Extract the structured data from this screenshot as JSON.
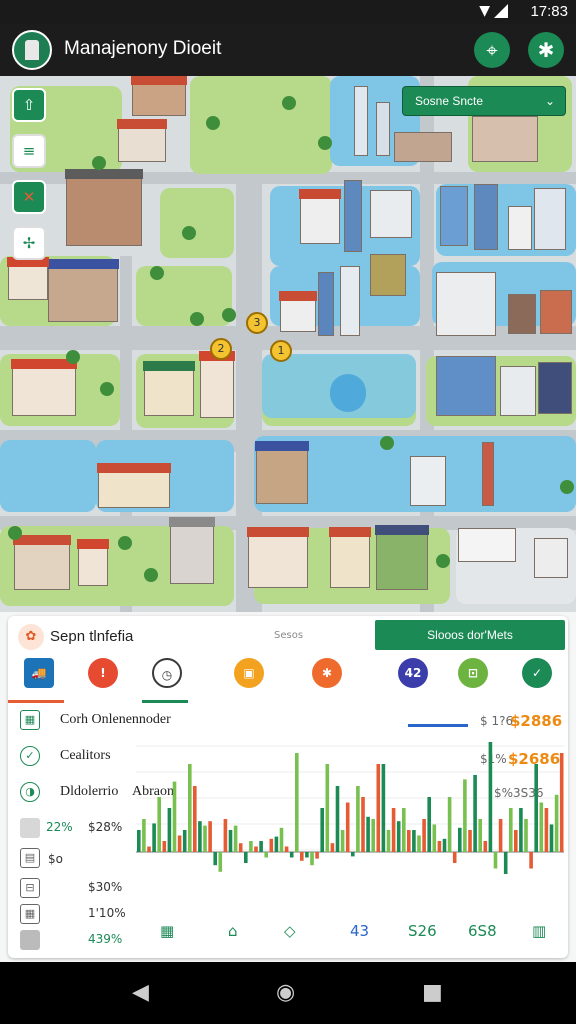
{
  "status": {
    "time": "17:83"
  },
  "app": {
    "title": "Manajenony Dioeit"
  },
  "map": {
    "dropdown_label": "Sosne Sncte",
    "side_buttons": [
      {
        "name": "compass-icon",
        "glyph": "⇧"
      },
      {
        "name": "layers-icon",
        "glyph": "≡"
      },
      {
        "name": "tools-icon",
        "glyph": "✕"
      },
      {
        "name": "fan-icon",
        "glyph": "✢"
      }
    ],
    "pins": [
      "3",
      "2",
      "1"
    ]
  },
  "panel": {
    "title": "Sepn tlnfefia",
    "subtitle": "Sesos",
    "cta_label": "Slooos dor'Mets",
    "categories": [
      {
        "name": "truck-icon",
        "glyph": "🚚",
        "color": "#1d73b8"
      },
      {
        "name": "alert-icon",
        "glyph": "!",
        "color": "#e64b32"
      },
      {
        "name": "clock-icon",
        "glyph": "◷",
        "color": "#3a3a3a"
      },
      {
        "name": "box-icon",
        "glyph": "▣",
        "color": "#f2a21e"
      },
      {
        "name": "gear-icon",
        "glyph": "✱",
        "color": "#ef6b2d"
      },
      {
        "name": "badge-icon",
        "glyph": "42",
        "color": "#3b3eaa"
      },
      {
        "name": "bag-icon",
        "glyph": "⊡",
        "color": "#6db33f"
      },
      {
        "name": "check-icon",
        "glyph": "✓",
        "color": "#1b8a55"
      }
    ],
    "rows": [
      {
        "label": "Corh Onlenennoder",
        "note": "$ 1?6",
        "amount": "$2886"
      },
      {
        "label": "Cealitors",
        "note": "$1%",
        "amount": "$2686"
      },
      {
        "label": "Dldolerrio",
        "sub": "Abraon",
        "note": "",
        "amount": "$%3S36"
      }
    ],
    "stats": [
      {
        "percent": "22%",
        "value": "$28%"
      },
      {
        "percent": "",
        "value": "$o"
      },
      {
        "percent": "",
        "value": "$30%"
      },
      {
        "percent": "",
        "value": "1'10%"
      },
      {
        "percent": "",
        "value": "439%"
      }
    ],
    "bottom_labels": [
      "43",
      "S26",
      "6S8"
    ]
  },
  "chart_data": {
    "type": "bar",
    "title": "",
    "xlabel": "",
    "ylabel": "",
    "series": [
      {
        "color": "#1b8a55",
        "values": [
          20,
          26,
          40,
          20,
          28,
          -12,
          20,
          -10,
          10,
          14,
          -5,
          -5,
          40,
          60,
          -4,
          32,
          80,
          28,
          20,
          50,
          12,
          22,
          70,
          100,
          -20,
          40,
          80,
          25
        ]
      },
      {
        "color": "#78c050",
        "values": [
          30,
          50,
          64,
          80,
          24,
          -18,
          24,
          10,
          -5,
          22,
          90,
          -12,
          80,
          20,
          60,
          30,
          20,
          40,
          15,
          25,
          50,
          66,
          30,
          -15,
          40,
          30,
          45,
          52
        ]
      },
      {
        "color": "#e45b34",
        "values": [
          5,
          10,
          15,
          60,
          28,
          30,
          8,
          5,
          12,
          5,
          -8,
          -6,
          8,
          45,
          50,
          80,
          40,
          20,
          30,
          10,
          -10,
          20,
          10,
          30,
          20,
          -15,
          40,
          90
        ]
      }
    ]
  }
}
